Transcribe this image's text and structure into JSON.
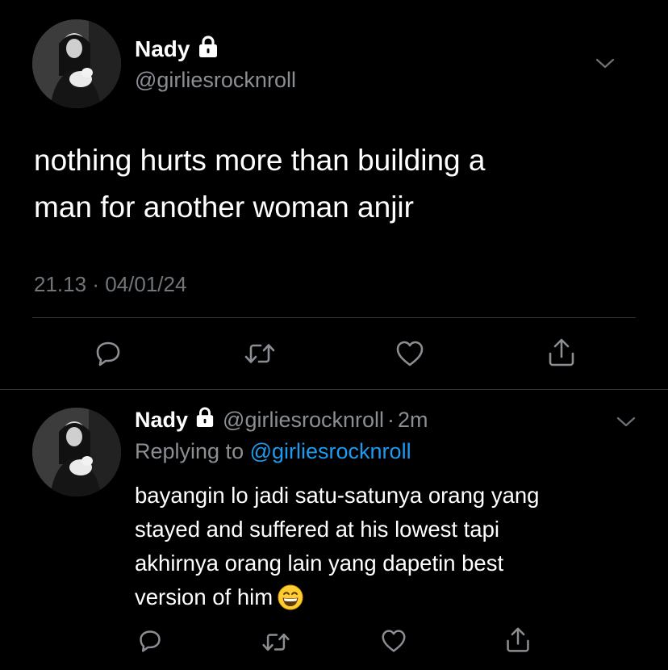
{
  "main_tweet": {
    "author_name": "Nady",
    "handle": "@girliesrocknroll",
    "text_line1": "nothing hurts more than building a",
    "text_line2": "man for another woman anjir",
    "time": "21.13",
    "separator": "·",
    "date": "04/01/24",
    "icons": {
      "lock": "lock-icon",
      "more": "chevron-down-icon",
      "reply": "reply-icon",
      "retweet": "retweet-icon",
      "like": "heart-icon",
      "share": "share-icon"
    }
  },
  "reply_tweet": {
    "author_name": "Nady",
    "handle": "@girliesrocknroll",
    "separator": "·",
    "time_ago": "2m",
    "replying_prefix": "Replying to",
    "replying_handle": "@girliesrocknroll",
    "text_line1": "bayangin lo jadi satu-satunya orang yang",
    "text_line2": "stayed and suffered at his lowest tapi",
    "text_line3": "akhirnya orang lain yang dapetin best",
    "text_line4": "version of him",
    "emoji": "grinning-face-with-smiling-eyes"
  },
  "colors": {
    "background": "#000000",
    "primary_text": "#ffffff",
    "secondary_text": "#8b8f94",
    "link": "#1d9bf0",
    "divider": "#2f3336"
  }
}
